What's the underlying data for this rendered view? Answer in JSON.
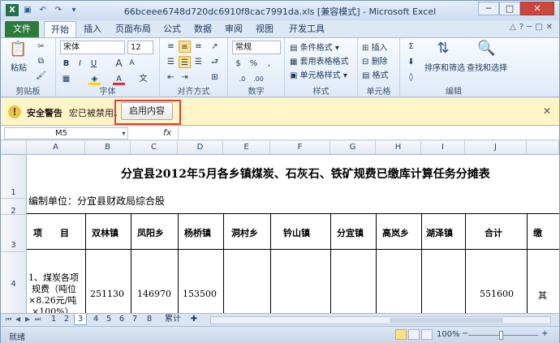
{
  "window": {
    "title": "66bceee6748d720dc6910f8cac7991da.xls  [兼容模式] - Microsoft Excel",
    "minimize": "─",
    "maximize": "□",
    "close": "✕"
  },
  "ribbon_tabs": [
    "文件",
    "开始",
    "插入",
    "页面布局",
    "公式",
    "数据",
    "审阅",
    "视图",
    "开发工具"
  ],
  "active_tab": "开始",
  "clipboard": {
    "paste": "粘贴",
    "label": "剪贴板"
  },
  "font": {
    "name": "宋体",
    "size": "12",
    "bold": "B",
    "italic": "I",
    "underline": "U",
    "grow": "A",
    "shrink": "A",
    "font_color": "A",
    "label": "字体"
  },
  "alignment": {
    "label": "对齐方式"
  },
  "number": {
    "format": "常规",
    "label": "数字"
  },
  "styles": {
    "cond_format": "条件格式",
    "table_format": "套用表格格式",
    "cell_styles": "单元格样式",
    "label": "样式"
  },
  "cells": {
    "insert": "插入",
    "delete": "删除",
    "format": "格式",
    "label": "单元格"
  },
  "editing": {
    "sort_filter": "排序和筛选",
    "find_select": "查找和选择",
    "label": "编辑"
  },
  "security_bar": {
    "title": "安全警告",
    "message": "宏已被禁用。",
    "enable_button": "启用内容",
    "close": "✕"
  },
  "formula_bar": {
    "name_box": "M5",
    "fx": "fx",
    "formula": ""
  },
  "columns": [
    "A",
    "B",
    "C",
    "D",
    "E",
    "F",
    "G",
    "H",
    "I",
    "J"
  ],
  "rows": [
    "1",
    "2",
    "3",
    "4"
  ],
  "sheet": {
    "title": "分宜县2012年5月各乡镇煤炭、石灰石、铁矿规费已缴库计算任务分摊表",
    "unit": "编制单位：分宜县财政局综合股",
    "headers": [
      "项　　目",
      "双林镇",
      "凤阳乡",
      "杨桥镇",
      "洞村乡",
      "钤山镇",
      "分宜镇",
      "高岚乡",
      "湖泽镇",
      "合计",
      "缴"
    ],
    "row4_label": [
      "1、煤炭各项",
      "规费（吨位",
      "×8.26元/吨",
      "×100%）"
    ],
    "row4_values": [
      "251130",
      "146970",
      "153500",
      "",
      "",
      "",
      "",
      "",
      "551600"
    ],
    "row4_tail": "其"
  },
  "sheet_tabs": [
    "1",
    "2",
    "3",
    "4",
    "5",
    "6",
    "7",
    "8",
    "累计"
  ],
  "active_sheet": "3",
  "statusbar": {
    "ready": "就绪",
    "zoom": "100%",
    "minus": "−",
    "plus": "+"
  }
}
